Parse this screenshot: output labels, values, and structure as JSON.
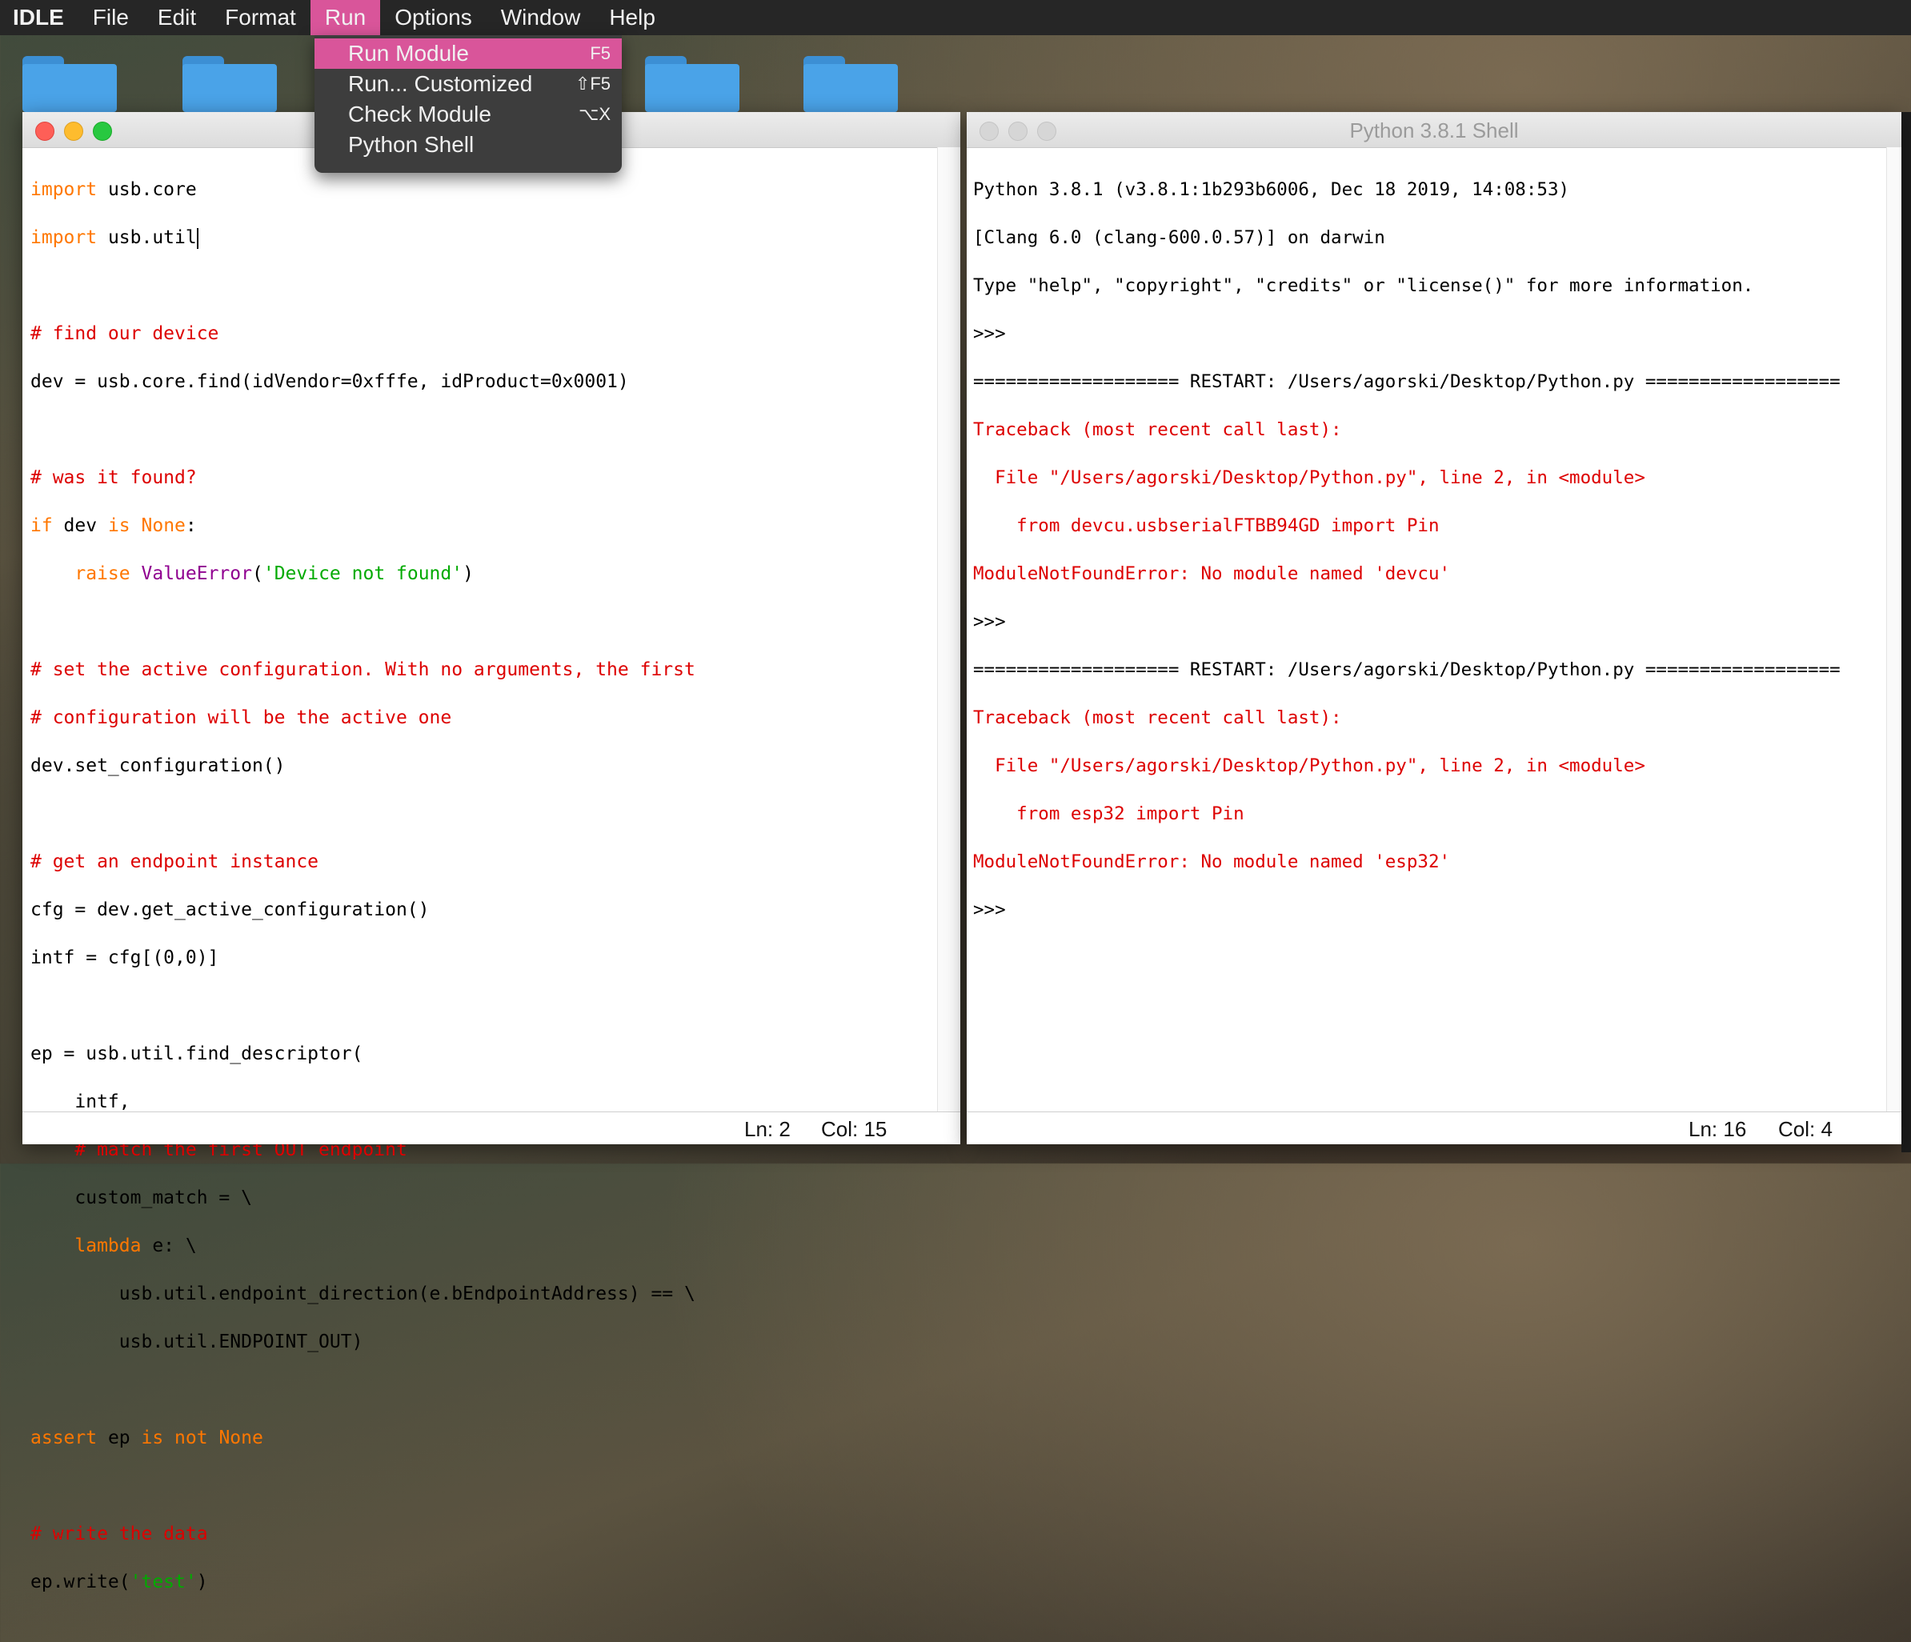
{
  "menubar": {
    "app": "IDLE",
    "items": [
      "File",
      "Edit",
      "Format",
      "Run",
      "Options",
      "Window",
      "Help"
    ],
    "active": "Run"
  },
  "run_menu": {
    "items": [
      {
        "label": "Run Module",
        "shortcut": "F5"
      },
      {
        "label": "Run... Customized",
        "shortcut": "⇧F5"
      },
      {
        "label": "Check Module",
        "shortcut": "⌥X"
      },
      {
        "label": "Python Shell",
        "shortcut": ""
      }
    ]
  },
  "editor": {
    "title": "",
    "status": {
      "ln": "Ln: 2",
      "col": "Col: 15"
    }
  },
  "shell": {
    "title": "Python 3.8.1 Shell",
    "status": {
      "ln": "Ln: 16",
      "col": "Col: 4"
    }
  },
  "colors": {
    "menu_highlight": "#d9559a",
    "keyword": "#ff7700",
    "comment": "#dd0000",
    "string": "#00aa00",
    "builtin": "#900090",
    "error": "#dd0000"
  }
}
